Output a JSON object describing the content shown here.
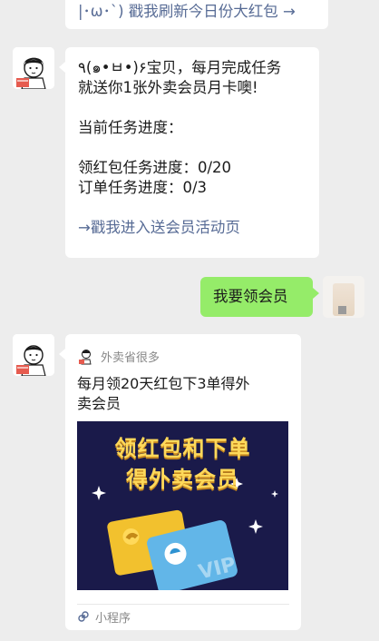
{
  "messages": {
    "top_link": "|･ω･`) 戳我刷新今日份大红包 →",
    "task_bubble": {
      "line1": "٩(๑•ㅂ•)۶宝贝，每月完成任务",
      "line2": "就送你1张外卖会员月卡噢!",
      "progress_title": "当前任务进度：",
      "hongbao_progress": "领红包任务进度：0/20",
      "order_progress": "订单任务进度：0/3",
      "link": "→戳我进入送会员活动页"
    },
    "user_message": "我要领会员"
  },
  "mini_program": {
    "source_name": "外卖省很多",
    "title_line1": "每月领20天红包下3单得外",
    "title_line2": "卖会员",
    "banner_line1": "领红包和下单",
    "banner_line2": "得外卖会员",
    "card_text": "VIP",
    "footer_label": "小程序"
  },
  "colors": {
    "chat_bg": "#ededed",
    "link_blue": "#576b95",
    "green_bubble": "#95ec69",
    "banner_bg": "#1a1a4a",
    "banner_text": "#ffd95a"
  }
}
